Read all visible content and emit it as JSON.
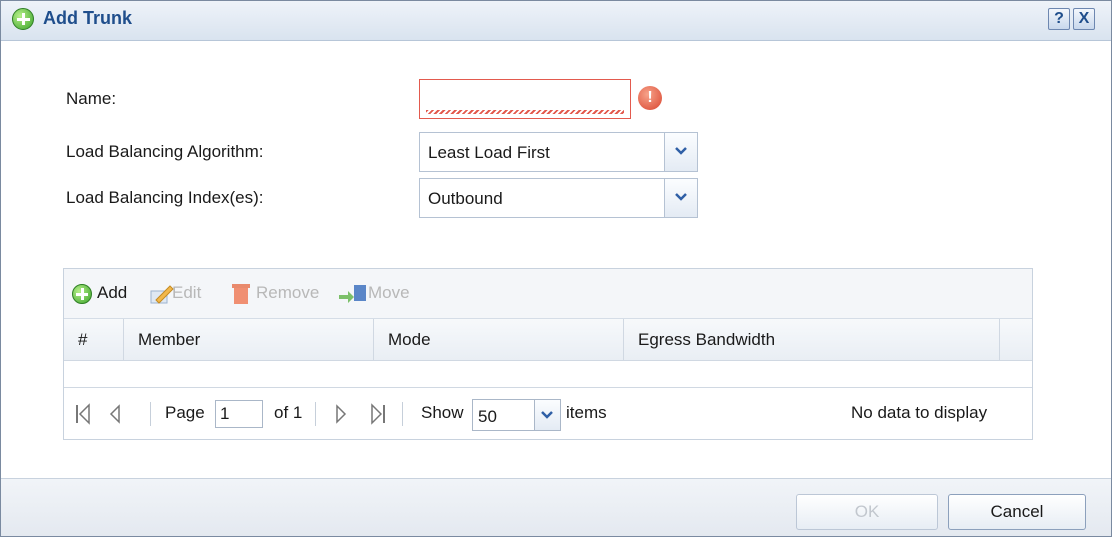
{
  "dialog": {
    "title": "Add Trunk",
    "help_label": "?",
    "close_label": "X"
  },
  "form": {
    "name_label": "Name:",
    "name_value": "",
    "algorithm_label": "Load Balancing Algorithm:",
    "algorithm_value": "Least Load First",
    "index_label": "Load Balancing Index(es):",
    "index_value": "Outbound",
    "error_glyph": "!"
  },
  "toolbar": {
    "add_label": "Add",
    "edit_label": "Edit",
    "remove_label": "Remove",
    "move_label": "Move"
  },
  "table": {
    "columns": [
      "#",
      "Member",
      "Mode",
      "Egress Bandwidth"
    ],
    "rows": []
  },
  "pager": {
    "page_label": "Page",
    "page_value": "1",
    "of_label": "of 1",
    "show_label": "Show",
    "show_value": "50",
    "items_label": "items",
    "empty_message": "No data to display"
  },
  "footer": {
    "ok_label": "OK",
    "cancel_label": "Cancel"
  },
  "colors": {
    "title_text": "#1f4e8c",
    "error_border": "#e35a4e",
    "add_green": "#3aa22a",
    "disabled_text": "#b8b8b8"
  }
}
